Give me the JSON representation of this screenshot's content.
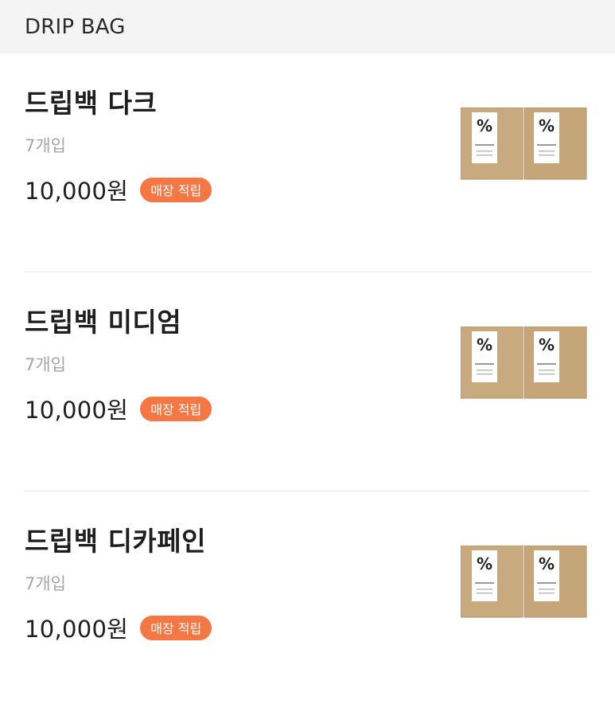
{
  "header": {
    "title": "DRIP BAG"
  },
  "products": [
    {
      "name": "드립백 다크",
      "quantity": "7개입",
      "price": "10,000원",
      "badge": "매장 적립",
      "image_icon": "drip-bag-box-image"
    },
    {
      "name": "드립백 미디엄",
      "quantity": "7개입",
      "price": "10,000원",
      "badge": "매장 적립",
      "image_icon": "drip-bag-box-image"
    },
    {
      "name": "드립백 디카페인",
      "quantity": "7개입",
      "price": "10,000원",
      "badge": "매장 적립",
      "image_icon": "drip-bag-box-image"
    }
  ],
  "colors": {
    "header_background": "#f4f4f4",
    "badge_background": "#f47744",
    "badge_text": "#ffffff",
    "quantity_text": "#a5a5a5",
    "kraft_box": "#c9a97e"
  }
}
